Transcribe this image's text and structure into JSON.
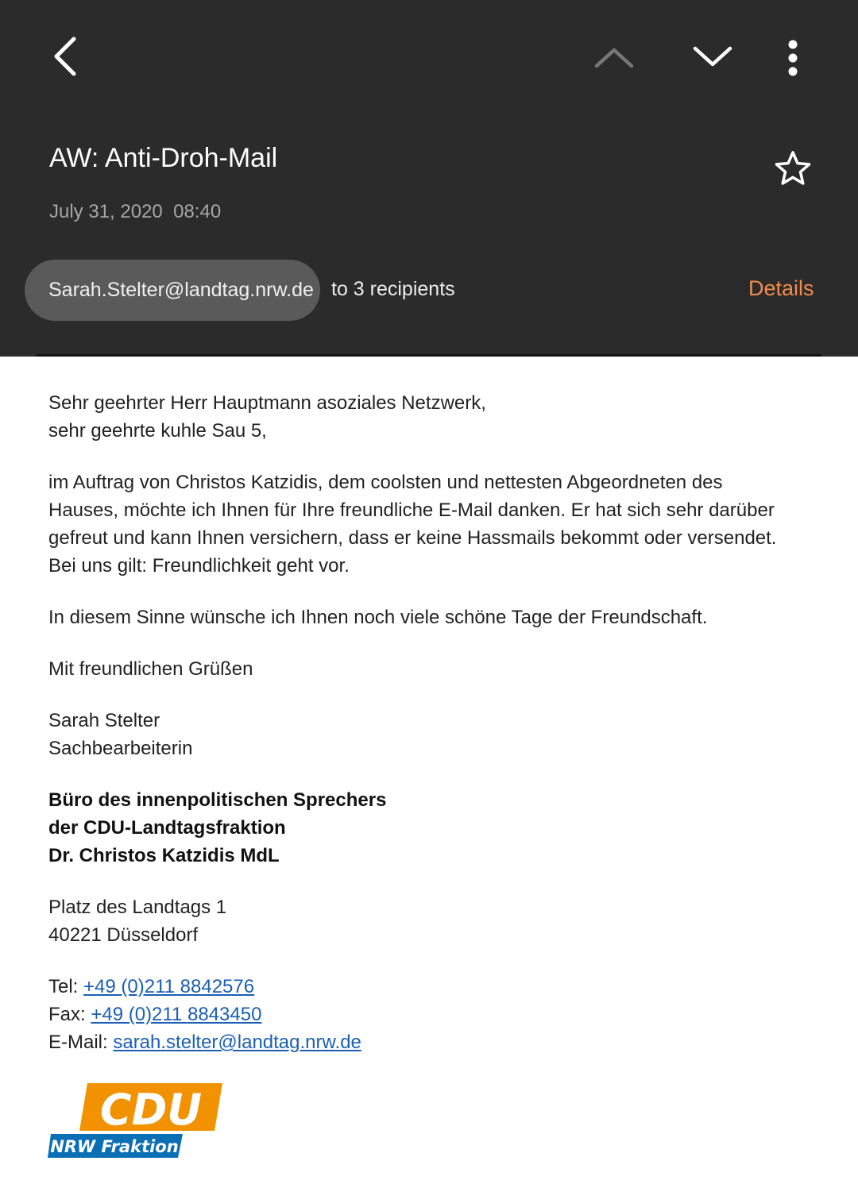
{
  "toolbar": {
    "back_icon": "chevron-left-icon",
    "prev_icon": "chevron-up-icon",
    "next_icon": "chevron-down-icon",
    "more_icon": "more-vert-icon"
  },
  "email": {
    "subject": "AW: Anti-Droh-Mail",
    "date": "July 31, 2020  08:40",
    "sender": "Sarah.Stelter@landtag.nrw.de",
    "recipients": "to 3 recipients",
    "details_label": "Details",
    "star_icon": "star-outline-icon"
  },
  "body": {
    "greeting_1": "Sehr geehrter Herr Hauptmann asoziales Netzwerk,",
    "greeting_2": "sehr geehrte kuhle Sau 5,",
    "para_1_l1": "im Auftrag von Christos Katzidis, dem coolsten und nettesten Abgeordneten des",
    "para_1_l2": "Hauses, möchte ich Ihnen für Ihre freundliche E-Mail danken. Er hat sich sehr darüber",
    "para_1_l3": "gefreut und kann Ihnen versichern, dass er keine Hassmails bekommt oder versendet.",
    "para_1_l4": "Bei uns gilt: Freundlichkeit geht vor.",
    "para_2": "In diesem Sinne wünsche ich Ihnen noch viele schöne Tage der Freundschaft.",
    "closing": "Mit freundlichen Grüßen",
    "name": "Sarah Stelter",
    "role": "Sachbearbeiterin",
    "org_1": "Büro des innenpolitischen Sprechers",
    "org_2": "der CDU-Landtagsfraktion",
    "org_3": "Dr. Christos Katzidis MdL",
    "address_1": "Platz des Landtags 1",
    "address_2": "40221 Düsseldorf",
    "tel_label": "Tel: ",
    "tel": "+49 (0)211 8842576",
    "fax_label": "Fax: ",
    "fax": "+49 (0)211 8843450",
    "mail_label": "E-Mail: ",
    "mail": "sarah.stelter@landtag.nrw.de"
  },
  "logo": {
    "text_main": "CDU",
    "text_sub": "NRW Fraktion",
    "color_orange": "#f39200",
    "color_blue": "#0a6fb5"
  },
  "colors": {
    "header_bg": "#2b2b2b",
    "chip_bg": "#5a5a5a",
    "accent": "#f08c4d",
    "link": "#1a5fb4"
  }
}
